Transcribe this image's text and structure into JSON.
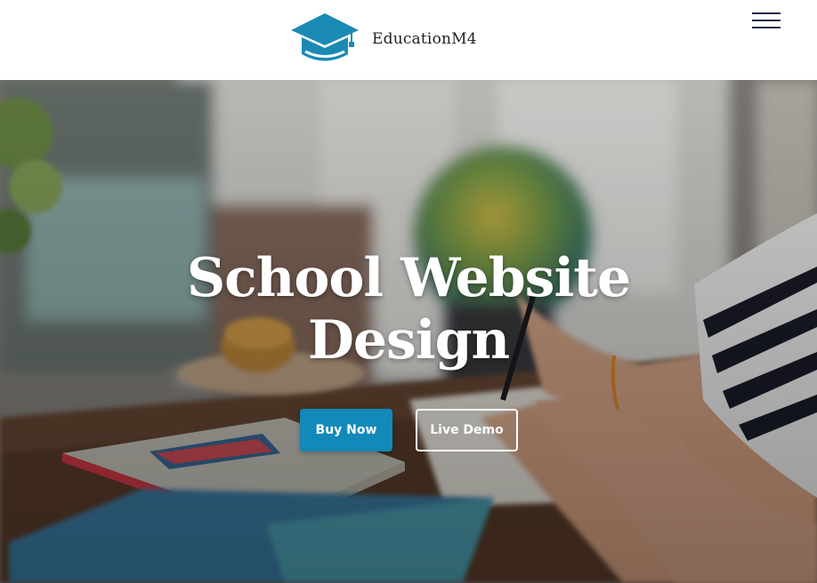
{
  "header": {
    "brand_name": "EducationM4",
    "logo_icon": "graduation-cap-icon",
    "menu_icon": "hamburger-menu-icon"
  },
  "hero": {
    "title_line1": "School Website",
    "title_line2": "Design",
    "buy_label": "Buy Now",
    "demo_label": "Live Demo"
  },
  "colors": {
    "accent": "#1289b8",
    "logo": "#1a8ab5",
    "menu": "#1c2a4a",
    "title": "#ffffff"
  }
}
